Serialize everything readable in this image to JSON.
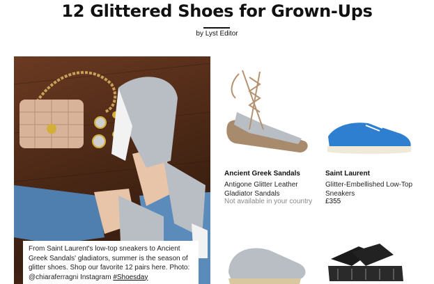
{
  "article": {
    "title": "12 Glittered Shoes for Grown-Ups",
    "byline": "by Lyst Editor"
  },
  "hero": {
    "caption_text": "From Saint Laurent's low-top sneakers to Ancient Greek Sandals' gladiators, summer is the season of glitter shoes. Shop our favorite 12 pairs here. Photo: @chiaraferragni Instagram ",
    "hashtag": "#Shoesday"
  },
  "products": [
    {
      "brand": "Ancient Greek Sandals",
      "name": "Antigone Glitter Leather Gladiator Sandals",
      "availability": "Not available in your country",
      "icon": "gladiator-sandal-icon"
    },
    {
      "brand": "Saint Laurent",
      "name": "Glitter-Embellished Low-Top Sneakers",
      "price": "£355",
      "icon": "glitter-sneaker-icon"
    },
    {
      "icon": "glitter-espadrille-icon"
    },
    {
      "icon": "black-platform-sandal-icon"
    }
  ],
  "colors": {
    "glitter": "#b9bec4",
    "blue_glitter": "#2f7fd0",
    "wood": "#4e2a17",
    "denim": "#4f7fae",
    "bag": "#d9b29a"
  }
}
